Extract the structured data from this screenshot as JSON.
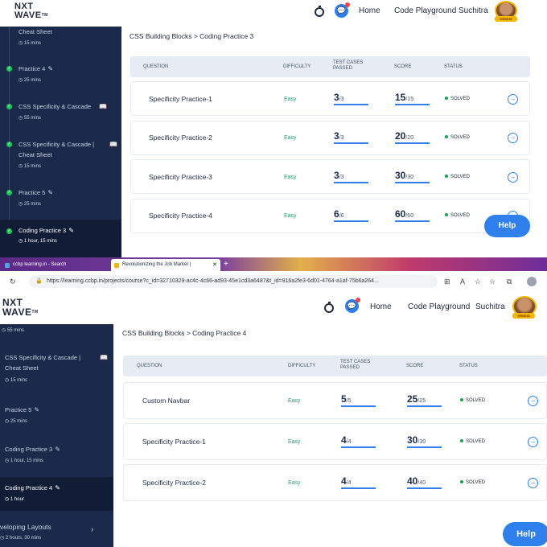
{
  "brand": {
    "line1": "NXT",
    "line2": "WAVE",
    "tm": "TM"
  },
  "nav": {
    "home": "Home",
    "code_playground": "Code Playground",
    "user": "Suchitra",
    "badge": "GENIUS",
    "chat_glyph": "💬",
    "timer_icon": "stopwatch-icon",
    "chat_icon": "chat-icon"
  },
  "top": {
    "sidebar": [
      {
        "title": "Cheat Sheet",
        "time": "15 mins",
        "completed": false
      },
      {
        "title": "Practice 4",
        "time": "25 mins",
        "completed": true
      },
      {
        "title": "CSS Specificity & Cascade",
        "time": "55 mins",
        "completed": true
      },
      {
        "title": "CSS Specificity & Cascade |",
        "title2": "Cheat Sheet",
        "time": "15 mins",
        "completed": true
      },
      {
        "title": "Practice 5",
        "time": "25 mins",
        "completed": true
      },
      {
        "title": "Coding Practice 3",
        "time": "1 hour, 15 mins",
        "completed": true,
        "active": true
      }
    ],
    "breadcrumb": "CSS Building Blocks > Coding Practice 3",
    "rows": [
      {
        "name": "Specificity Practice-1",
        "difficulty": "Easy",
        "tests": "3",
        "tests_total": "/3",
        "score": "15",
        "score_total": "/15",
        "status": "SOLVED"
      },
      {
        "name": "Specificity Practice-2",
        "difficulty": "Easy",
        "tests": "3",
        "tests_total": "/3",
        "score": "20",
        "score_total": "/20",
        "status": "SOLVED"
      },
      {
        "name": "Specificity Practice-3",
        "difficulty": "Easy",
        "tests": "3",
        "tests_total": "/3",
        "score": "30",
        "score_total": "/30",
        "status": "SOLVED"
      },
      {
        "name": "Specificity Practice-4",
        "difficulty": "Easy",
        "tests": "6",
        "tests_total": "/6",
        "score": "60",
        "score_total": "/60",
        "status": "SOLVED"
      }
    ]
  },
  "table_headers": {
    "question": "QUESTION",
    "difficulty": "DIFFICULTY",
    "tests": "TEST CASES",
    "tests2": "PASSED",
    "score": "SCORE",
    "status": "STATUS"
  },
  "help_label": "Help",
  "browser": {
    "tab1": "ccbp learning.in - Search",
    "tab2": "Revolutionizing the Job Market |",
    "new_tab": "+",
    "url": "https://learning.ccbp.in/projects/course?c_id=32710329-ac4c-4c66-ad93-45e1cd3a6487&t_id=916a2fe3-6d01-4764-a1af-75b6a264...",
    "close": "✕"
  },
  "bottom": {
    "sidebar": [
      {
        "title": "",
        "time": "55 mins"
      },
      {
        "title": "CSS Specificity & Cascade |",
        "title2": "Cheat Sheet",
        "time": "15 mins"
      },
      {
        "title": "Practice 5",
        "time": "25 mins"
      },
      {
        "title": "Coding Practice 3",
        "time": "1 hour, 15 mins"
      },
      {
        "title": "Coding Practice 4",
        "time": "1 hour",
        "active": true
      },
      {
        "title": "veloping Layouts",
        "time": "2 hours, 30 mins"
      }
    ],
    "breadcrumb": "CSS Building Blocks > Coding Practice 4",
    "rows": [
      {
        "name": "Custom Navbar",
        "difficulty": "Easy",
        "tests": "5",
        "tests_total": "/5",
        "score": "25",
        "score_total": "/25",
        "status": "SOLVED"
      },
      {
        "name": "Specificity Practice-1",
        "difficulty": "Easy",
        "tests": "4",
        "tests_total": "/4",
        "score": "30",
        "score_total": "/30",
        "status": "SOLVED"
      },
      {
        "name": "Specificity Practice-2",
        "difficulty": "Easy",
        "tests": "4",
        "tests_total": "/4",
        "score": "40",
        "score_total": "/40",
        "status": "SOLVED"
      }
    ]
  },
  "colors": {
    "sidebar": "#1b2a4a",
    "accent": "#2f80ed",
    "easy": "#21a36c",
    "solved": "#16a34a"
  }
}
